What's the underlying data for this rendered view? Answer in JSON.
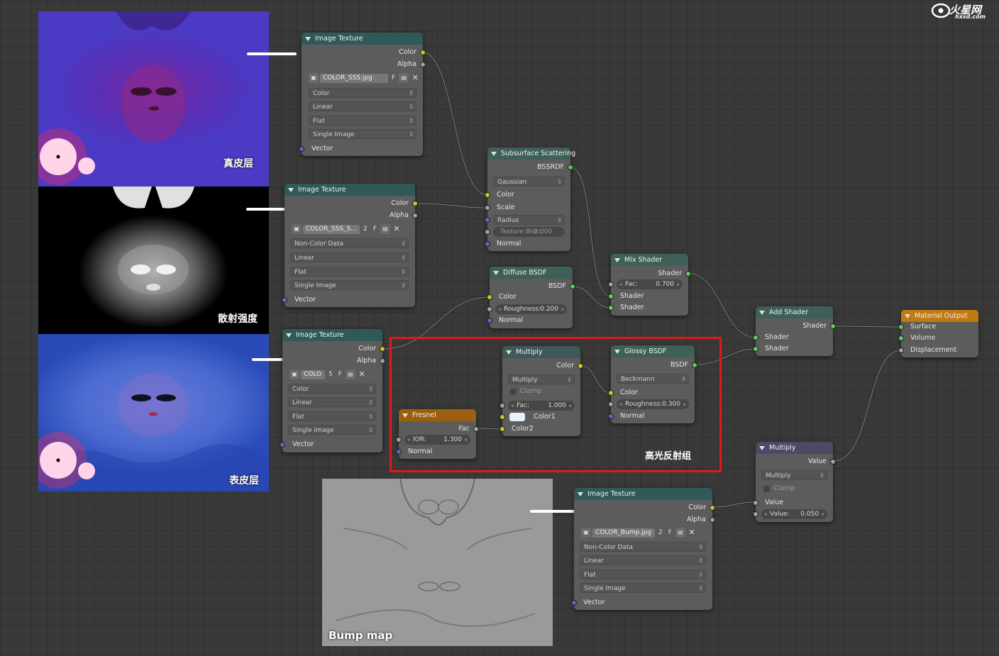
{
  "logo": {
    "main": "火星网",
    "sub": "hxsd.com"
  },
  "panels": {
    "dermis_label": "真皮层",
    "scatter_label": "散射强度",
    "epidermis_label": "表皮层",
    "bump_label": "Bump map"
  },
  "highlight_group_label": "高光反射组",
  "nodes": {
    "tex1": {
      "title": "Image Texture",
      "out_color": "Color",
      "out_alpha": "Alpha",
      "image": "COLOR_SSS.jpg",
      "f": "F",
      "color_space": "Color",
      "interp": "Linear",
      "proj": "Flat",
      "source": "Single Image",
      "in_vector": "Vector"
    },
    "tex2": {
      "title": "Image Texture",
      "out_color": "Color",
      "out_alpha": "Alpha",
      "image": "COLOR_SSS_S...",
      "users": "2",
      "f": "F",
      "color_space": "Non-Color Data",
      "interp": "Linear",
      "proj": "Flat",
      "source": "Single Image",
      "in_vector": "Vector"
    },
    "tex3": {
      "title": "Image Texture",
      "out_color": "Color",
      "out_alpha": "Alpha",
      "image": "COLO",
      "users": "5",
      "f": "F",
      "color_space": "Color",
      "interp": "Linear",
      "proj": "Flat",
      "source": "Single Image",
      "in_vector": "Vector"
    },
    "tex4": {
      "title": "Image Texture",
      "out_color": "Color",
      "out_alpha": "Alpha",
      "image": "COLOR_Bump.jpg",
      "users": "2",
      "f": "F",
      "color_space": "Non-Color Data",
      "interp": "Linear",
      "proj": "Flat",
      "source": "Single Image",
      "in_vector": "Vector"
    },
    "sss": {
      "title": "Subsurface Scattering",
      "out": "BSSRDF",
      "falloff": "Gaussian",
      "in_color": "Color",
      "in_scale": "Scale",
      "in_radius": "Radius",
      "blur_label": "Texture Blur:",
      "blur_value": "0.000",
      "in_normal": "Normal"
    },
    "diffuse": {
      "title": "Diffuse BSDF",
      "out": "BSDF",
      "in_color": "Color",
      "rough_label": "Roughness:",
      "rough_value": "0.200",
      "in_normal": "Normal"
    },
    "mix": {
      "title": "Mix Shader",
      "out": "Shader",
      "fac_label": "Fac:",
      "fac_value": "0.700",
      "in_shader1": "Shader",
      "in_shader2": "Shader"
    },
    "add": {
      "title": "Add Shader",
      "out": "Shader",
      "in_shader1": "Shader",
      "in_shader2": "Shader"
    },
    "output": {
      "title": "Material Output",
      "in_surface": "Surface",
      "in_volume": "Volume",
      "in_displacement": "Displacement"
    },
    "multiply_color": {
      "title": "Multiply",
      "out": "Color",
      "blend": "Multiply",
      "clamp": "Clamp",
      "fac_label": "Fac:",
      "fac_value": "1.000",
      "in_color1": "Color1",
      "in_color2": "Color2"
    },
    "glossy": {
      "title": "Glossy BSDF",
      "out": "BSDF",
      "distribution": "Beckmann",
      "in_color": "Color",
      "rough_label": "Roughness:",
      "rough_value": "0.300",
      "in_normal": "Normal"
    },
    "fresnel": {
      "title": "Fresnel",
      "out": "Fac",
      "ior_label": "IOR:",
      "ior_value": "1.300",
      "in_normal": "Normal"
    },
    "multiply_math": {
      "title": "Multiply",
      "out": "Value",
      "operation": "Multiply",
      "clamp": "Clamp",
      "in_value": "Value",
      "val_label": "Value:",
      "val_value": "0.050"
    }
  }
}
